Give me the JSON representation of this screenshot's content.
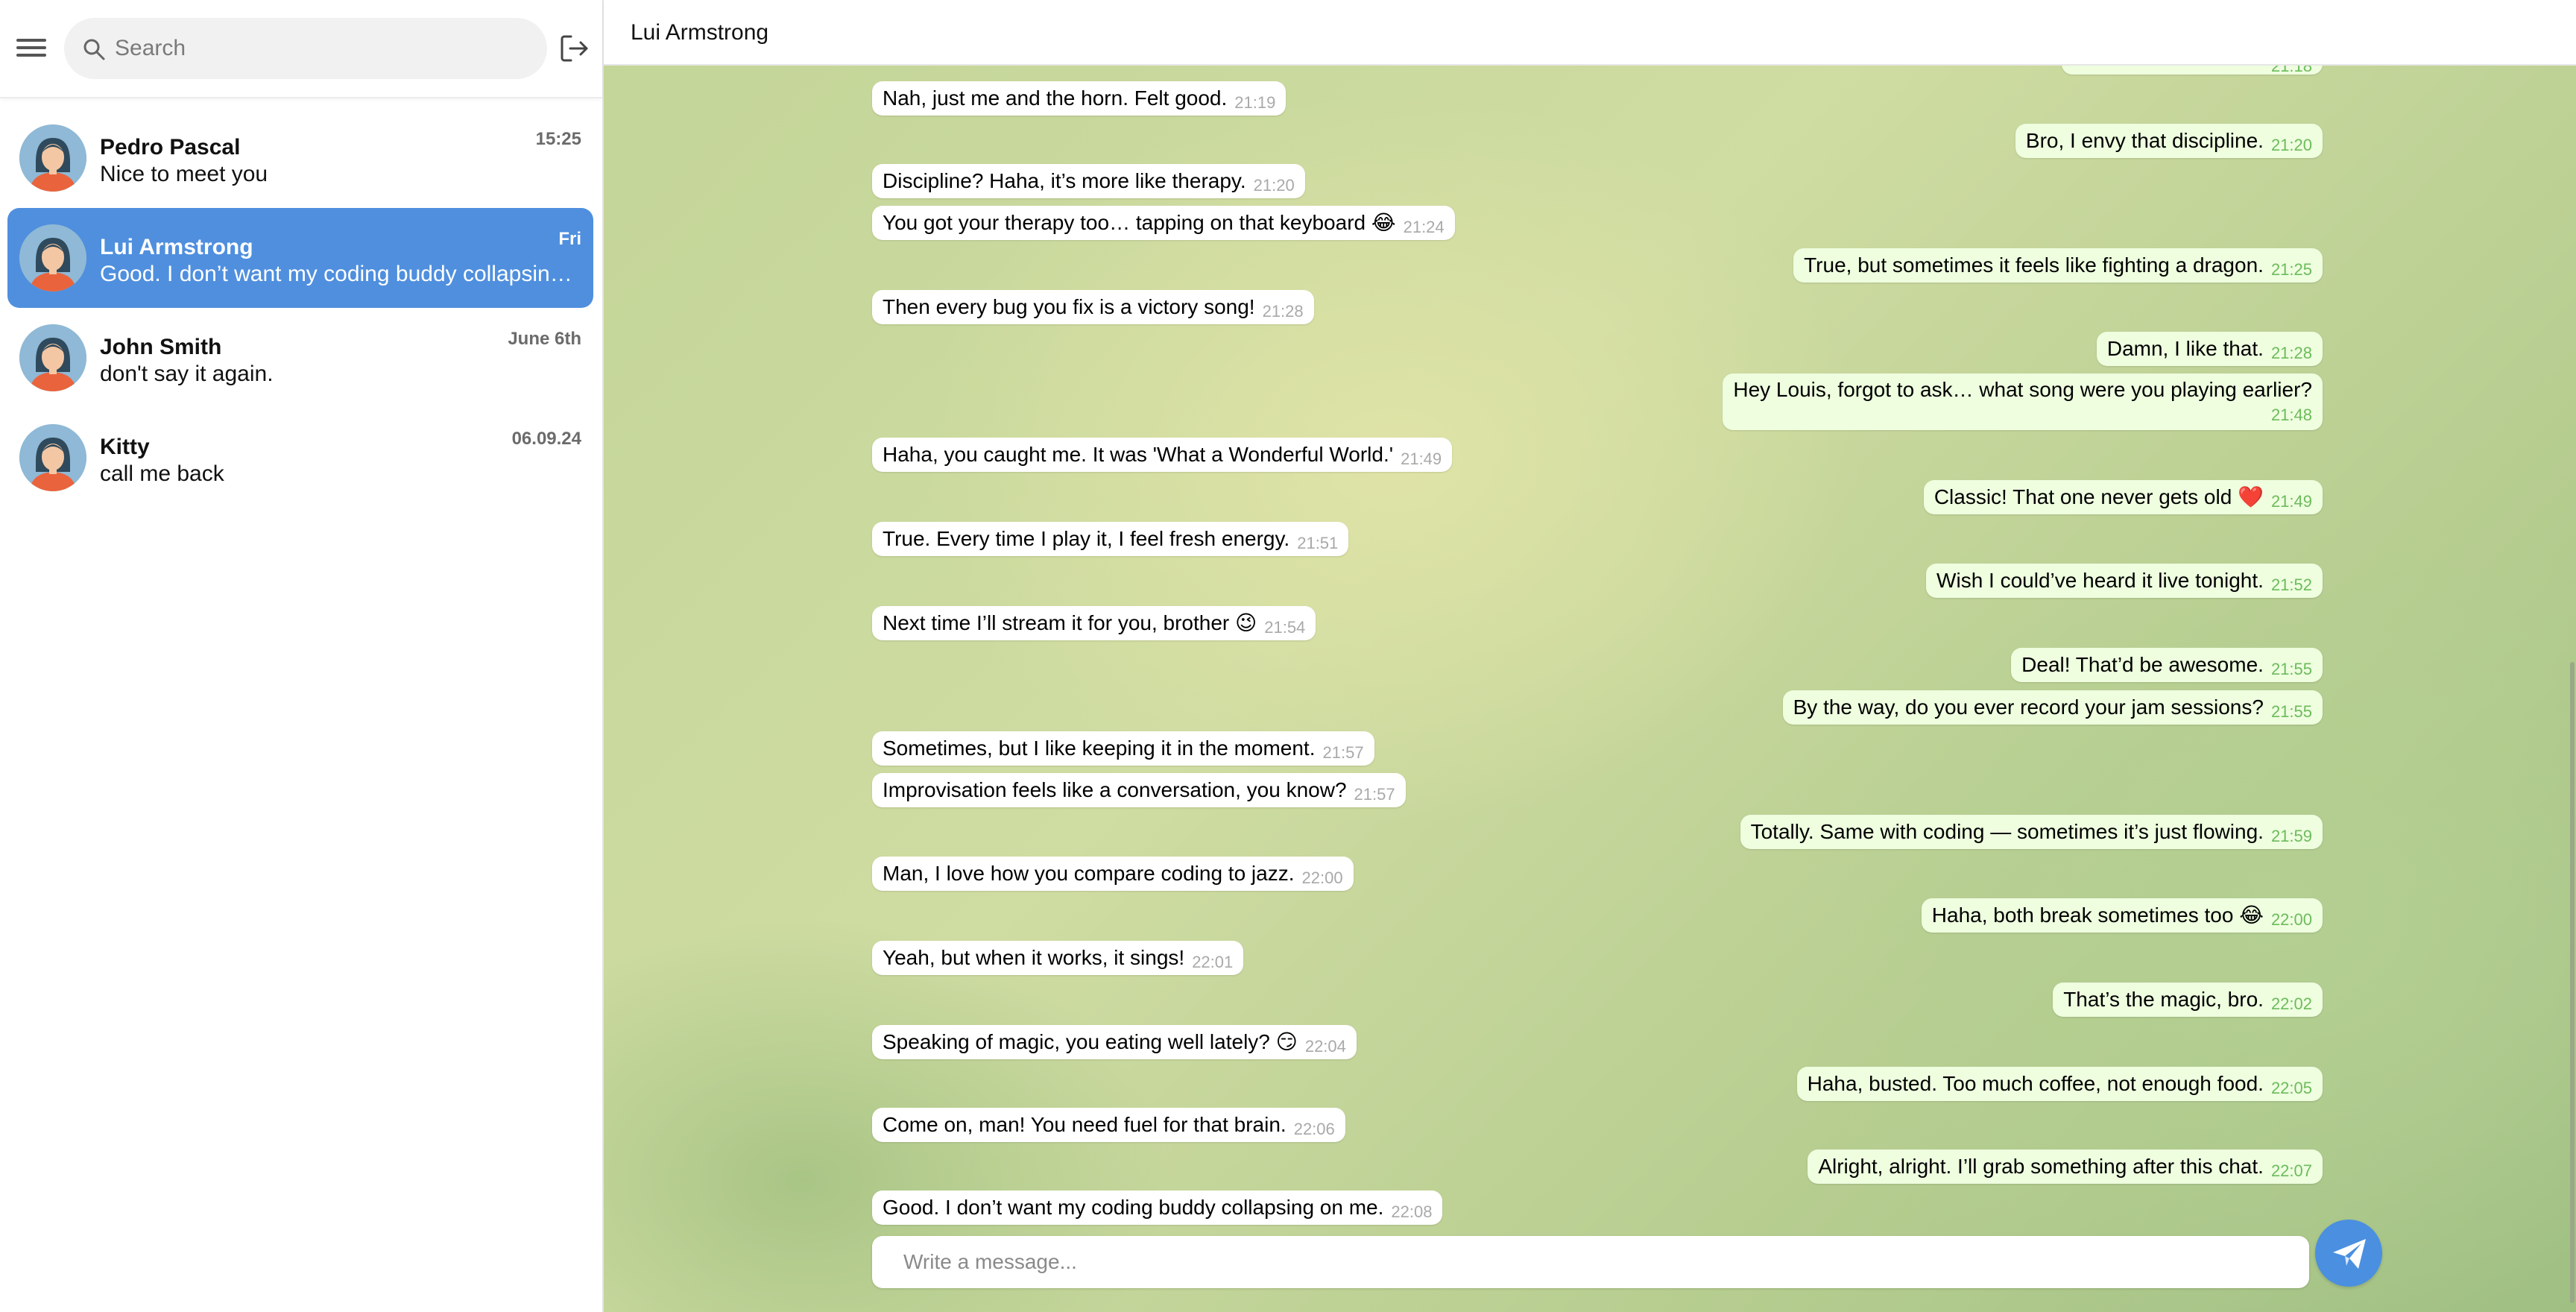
{
  "colors": {
    "accent": "#4f8fde",
    "outgoing_bubble": "#eefedf",
    "incoming_bubble": "#ffffff",
    "outgoing_time": "#6dbb5c",
    "incoming_time": "#a9a9a9"
  },
  "sidebar": {
    "menu_icon": "hamburger-menu-icon",
    "search": {
      "placeholder": "Search",
      "value": ""
    },
    "logout_icon": "logout-icon",
    "chats": [
      {
        "name": "Pedro Pascal",
        "preview": "Nice to meet you",
        "time": "15:25",
        "active": false
      },
      {
        "name": "Lui Armstrong",
        "preview": "Good. I don’t want my coding buddy collapsing on me.",
        "time": "Fri",
        "active": true
      },
      {
        "name": "John Smith",
        "preview": "don't say it again.",
        "time": "June 6th",
        "active": false
      },
      {
        "name": "Kitty",
        "preview": "call me back",
        "time": "06.09.24",
        "active": false
      }
    ]
  },
  "conversation": {
    "title": "Lui Armstrong",
    "partial_top_time": "21:18",
    "messages": [
      {
        "dir": "in",
        "text": "Nah, just me and the horn. Felt good.",
        "time": "21:19"
      },
      {
        "dir": "out",
        "text": "Bro, I envy that discipline.",
        "time": "21:20"
      },
      {
        "dir": "in",
        "text": "Discipline? Haha, it’s more like therapy.",
        "time": "21:20"
      },
      {
        "dir": "in",
        "text": "You got your therapy too… tapping on that keyboard 😂",
        "time": "21:24"
      },
      {
        "dir": "out",
        "text": "True, but sometimes it feels like fighting a dragon.",
        "time": "21:25"
      },
      {
        "dir": "in",
        "text": "Then every bug you fix is a victory song!",
        "time": "21:28"
      },
      {
        "dir": "out",
        "text": "Damn, I like that.",
        "time": "21:28"
      },
      {
        "dir": "out",
        "text": "Hey Louis, forgot to ask… what song were you playing earlier?",
        "time": "21:48"
      },
      {
        "dir": "in",
        "text": "Haha, you caught me. It was 'What a Wonderful World.'",
        "time": "21:49"
      },
      {
        "dir": "out",
        "text": "Classic! That one never gets old ❤️",
        "time": "21:49"
      },
      {
        "dir": "in",
        "text": "True. Every time I play it, I feel fresh energy.",
        "time": "21:51"
      },
      {
        "dir": "out",
        "text": "Wish I could’ve heard it live tonight.",
        "time": "21:52"
      },
      {
        "dir": "in",
        "text": "Next time I’ll stream it for you, brother 😉",
        "time": "21:54"
      },
      {
        "dir": "out",
        "text": "Deal! That’d be awesome.",
        "time": "21:55"
      },
      {
        "dir": "out",
        "text": "By the way, do you ever record your jam sessions?",
        "time": "21:55"
      },
      {
        "dir": "in",
        "text": "Sometimes, but I like keeping it in the moment.",
        "time": "21:57"
      },
      {
        "dir": "in",
        "text": "Improvisation feels like a conversation, you know?",
        "time": "21:57"
      },
      {
        "dir": "out",
        "text": "Totally. Same with coding — sometimes it’s just flowing.",
        "time": "21:59"
      },
      {
        "dir": "in",
        "text": "Man, I love how you compare coding to jazz.",
        "time": "22:00"
      },
      {
        "dir": "out",
        "text": "Haha, both break sometimes too 😂",
        "time": "22:00"
      },
      {
        "dir": "in",
        "text": "Yeah, but when it works, it sings!",
        "time": "22:01"
      },
      {
        "dir": "out",
        "text": "That’s the magic, bro.",
        "time": "22:02"
      },
      {
        "dir": "in",
        "text": "Speaking of magic, you eating well lately? 😏",
        "time": "22:04"
      },
      {
        "dir": "out",
        "text": "Haha, busted. Too much coffee, not enough food.",
        "time": "22:05"
      },
      {
        "dir": "in",
        "text": "Come on, man! You need fuel for that brain.",
        "time": "22:06"
      },
      {
        "dir": "out",
        "text": "Alright, alright. I’ll grab something after this chat.",
        "time": "22:07"
      },
      {
        "dir": "in",
        "text": "Good. I don’t want my coding buddy collapsing on me.",
        "time": "22:08"
      }
    ]
  },
  "composer": {
    "placeholder": "Write a message...",
    "value": "",
    "send_icon": "send-icon"
  }
}
